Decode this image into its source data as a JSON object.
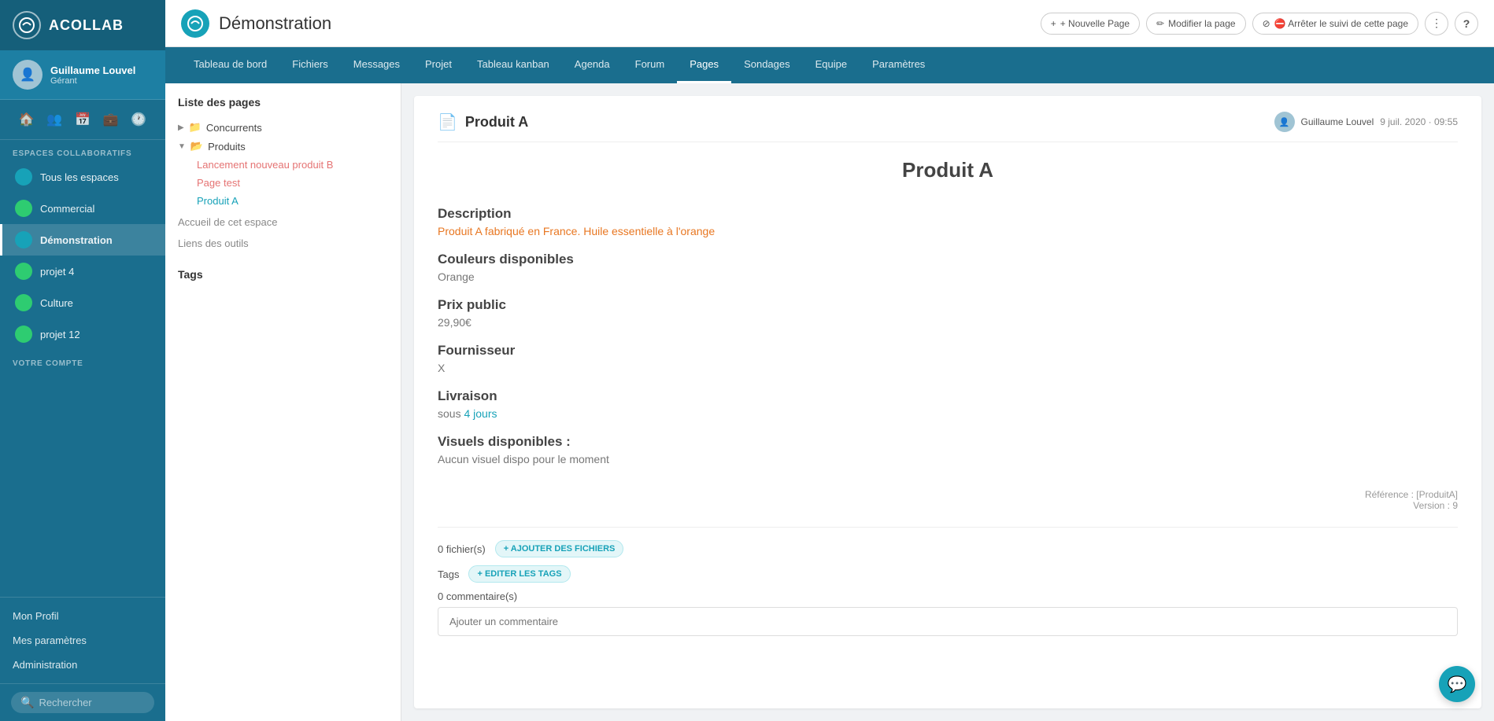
{
  "sidebar": {
    "logo_text": "ACOLLAB",
    "user": {
      "name": "Guillaume Louvel",
      "role": "Gérant"
    },
    "icons": [
      "🏠",
      "👥",
      "📅",
      "💼",
      "🕐"
    ],
    "collaborative_label": "ESPACES COLLABORATIFS",
    "spaces": [
      {
        "label": "Tous les espaces",
        "active": false,
        "color": "#17a2b8"
      },
      {
        "label": "Commercial",
        "active": false,
        "color": "#2ecc71"
      },
      {
        "label": "Démonstration",
        "active": true,
        "color": "#17a2b8"
      },
      {
        "label": "projet 4",
        "active": false,
        "color": "#2ecc71"
      },
      {
        "label": "Culture",
        "active": false,
        "color": "#2ecc71"
      },
      {
        "label": "projet 12",
        "active": false,
        "color": "#2ecc71"
      }
    ],
    "account_label": "VOTRE COMPTE",
    "account_items": [
      "Mon Profil",
      "Mes paramètres",
      "Administration"
    ],
    "search_placeholder": "Rechercher"
  },
  "header": {
    "title": "Démonstration",
    "buttons": {
      "new_page": "+ Nouvelle Page",
      "edit_page": "✏ Modifier la page",
      "stop_follow": "⛔ Arrêter le suivi de cette page"
    }
  },
  "nav": {
    "items": [
      "Tableau de bord",
      "Fichiers",
      "Messages",
      "Projet",
      "Tableau kanban",
      "Agenda",
      "Forum",
      "Pages",
      "Sondages",
      "Equipe",
      "Paramètres"
    ],
    "active": "Pages"
  },
  "page_list": {
    "title": "Liste des pages",
    "tree": [
      {
        "label": "Concurrents",
        "type": "folder",
        "collapsed": true,
        "children": []
      },
      {
        "label": "Produits",
        "type": "folder",
        "collapsed": false,
        "children": [
          {
            "label": "Lancement nouveau produit B",
            "color": "red"
          },
          {
            "label": "Page test",
            "color": "red"
          },
          {
            "label": "Produit A",
            "color": "teal"
          }
        ]
      }
    ],
    "root_items": [
      "Accueil de cet espace",
      "Liens des outils"
    ],
    "tags_label": "Tags"
  },
  "page_content": {
    "icon": "📄",
    "name": "Produit A",
    "author": "Guillaume Louvel",
    "date": "9 juil. 2020 · 09:55",
    "main_title": "Produit A",
    "sections": [
      {
        "title": "Description",
        "value": "Produit A fabriqué en France. Huile essentielle à l'orange",
        "style": "orange"
      },
      {
        "title": "Couleurs disponibles",
        "value": "Orange",
        "style": "normal"
      },
      {
        "title": "Prix public",
        "value": "29,90€",
        "style": "normal"
      },
      {
        "title": "Fournisseur",
        "value": "X",
        "style": "normal"
      },
      {
        "title": "Livraison",
        "value_prefix": "sous ",
        "value_highlight": "4 jours",
        "style": "highlight"
      },
      {
        "title": "Visuels disponibles :",
        "value": "Aucun visuel dispo pour le moment",
        "style": "normal"
      }
    ],
    "meta": {
      "reference": "Référence : [ProduitA]",
      "version": "Version : 9"
    },
    "files_count": "0 fichier(s)",
    "add_files_btn": "+ AJOUTER DES FICHIERS",
    "tags_label": "Tags",
    "edit_tags_btn": "+ EDITER LES TAGS",
    "comments_count": "0 commentaire(s)",
    "comment_placeholder": "Ajouter un commentaire"
  },
  "chat_bubble": "💬"
}
